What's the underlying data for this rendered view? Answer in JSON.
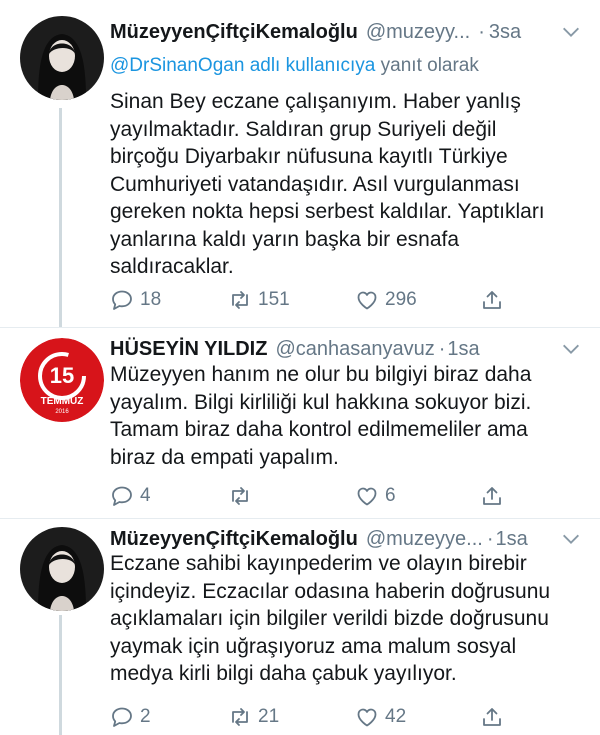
{
  "tweets": [
    {
      "name": "MüzeyyenÇiftçiKemaloğlu",
      "handle": "@muzeyy...",
      "time": "3sa",
      "reply_mention": "@DrSinanOgan adlı kullanıcıya",
      "reply_suffix": "yanıt olarak",
      "lines": [
        "Sinan Bey eczane çalışanıyım. Haber yanlış",
        "yayılmaktadır. Saldıran grup Suriyeli değil",
        "birçoğu Diyarbakır nüfusuna kayıtlı Türkiye",
        "Cumhuriyeti vatandaşıdır. Asıl vurgulanması",
        "gereken nokta hepsi serbest kaldılar. Yaptıkları",
        "yanlarına kaldı yarın başka bir esnafa",
        "saldıracaklar."
      ],
      "replies": "18",
      "retweets": "151",
      "likes": "296"
    },
    {
      "name": "HÜSEYİN YILDIZ",
      "handle": "@canhasanyavuz",
      "time": "1sa",
      "avatar_text_top": "15",
      "avatar_text_bottom": "TEMMUZ",
      "avatar_year": "2016",
      "lines": [
        "Müzeyyen hanım ne olur bu bilgiyi biraz daha",
        "yayalım. Bilgi kirliliği kul hakkına sokuyor bizi.",
        "Tamam biraz daha kontrol edilmemeliler ama",
        "biraz da empati yapalım."
      ],
      "replies": "4",
      "retweets": "",
      "likes": "6"
    },
    {
      "name": "MüzeyyenÇiftçiKemaloğlu",
      "handle": "@muzeyye...",
      "time": "1sa",
      "lines": [
        "Eczane sahibi kayınpederim ve olayın birebir",
        "içindeyiz. Eczacılar odasına haberin doğrusunu",
        "açıklamaları için bilgiler verildi bizde doğrusunu",
        "yaymak için uğraşıyoruz ama malum sosyal",
        "medya kirli bilgi daha çabuk yayılıyor."
      ],
      "replies": "2",
      "retweets": "21",
      "likes": "42"
    }
  ],
  "colors": {
    "text": "#14171a",
    "muted": "#657786",
    "link": "#1b95e0",
    "badge_red": "#d7141a"
  },
  "icons": [
    "chevron-down-icon",
    "reply-icon",
    "retweet-icon",
    "like-icon",
    "share-icon"
  ]
}
